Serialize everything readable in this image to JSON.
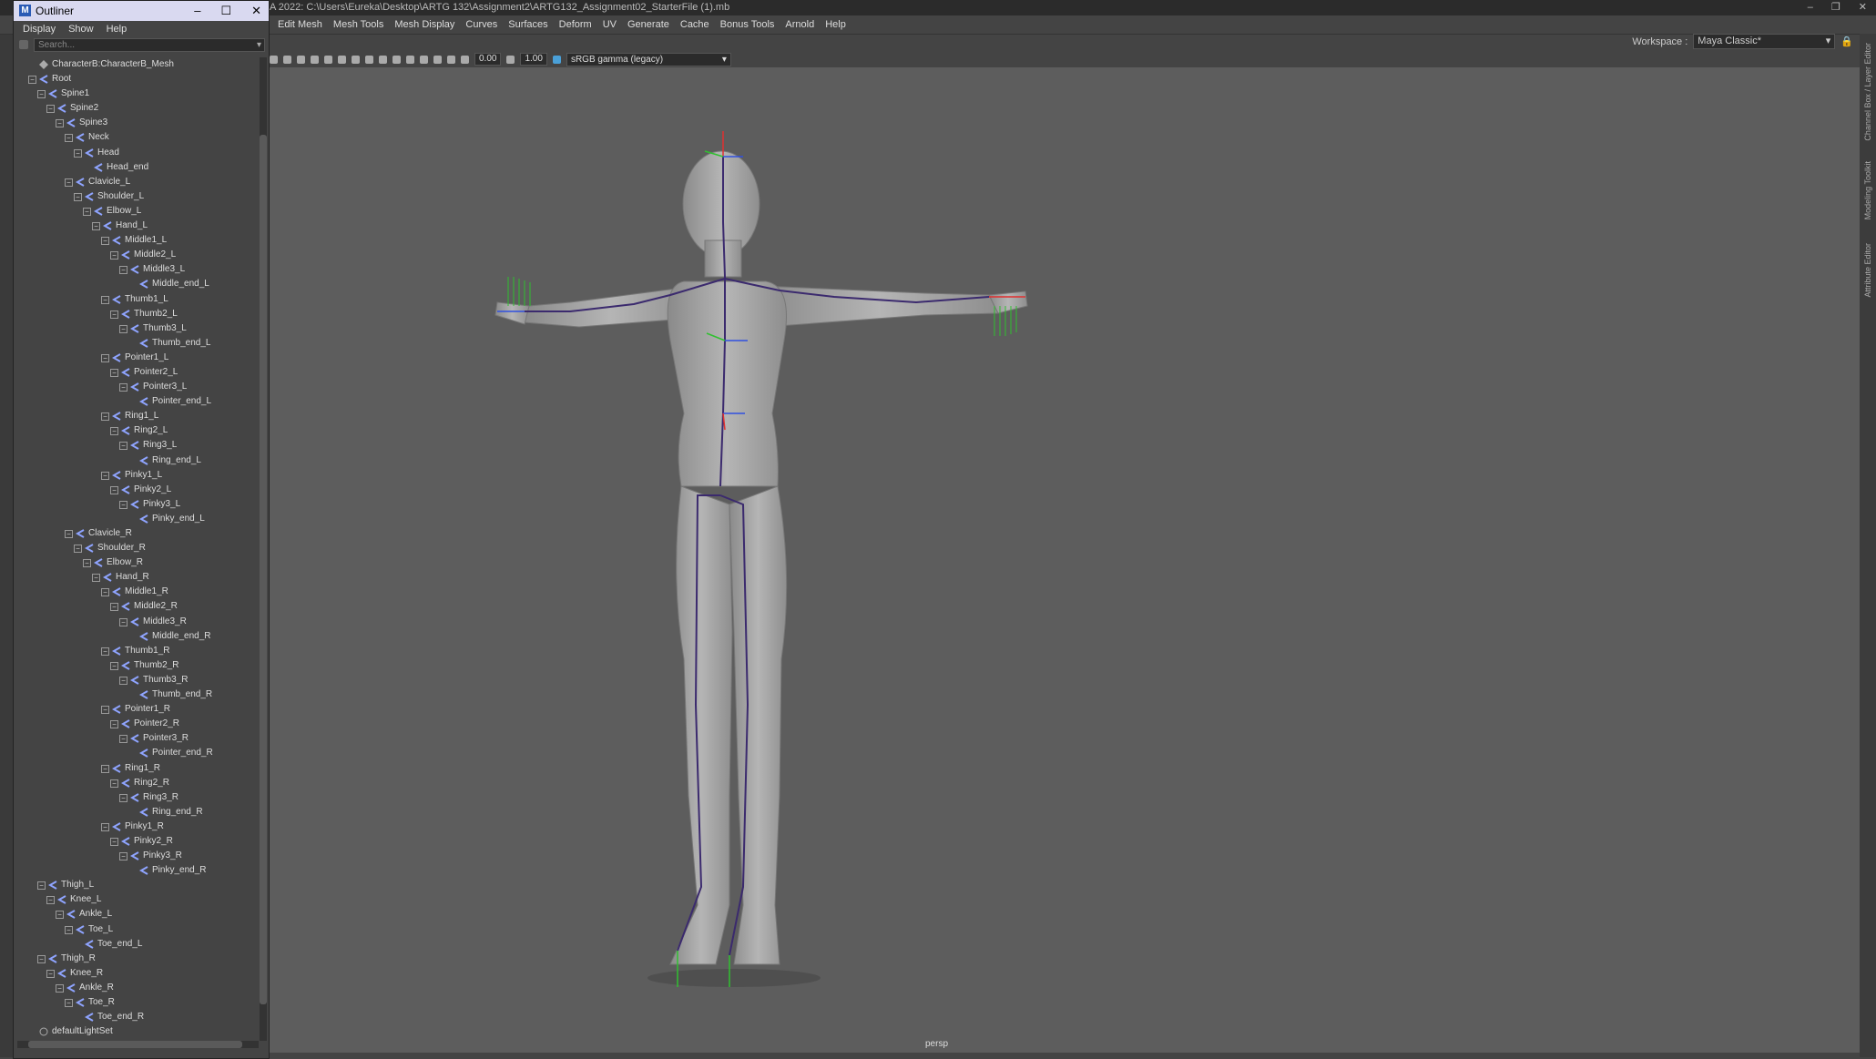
{
  "window": {
    "title": "A 2022: C:\\Users\\Eureka\\Desktop\\ARTG 132\\Assignment2\\ARTG132_Assignment02_StarterFile (1).mb"
  },
  "menubar": {
    "items": [
      "Edit Mesh",
      "Mesh Tools",
      "Mesh Display",
      "Curves",
      "Surfaces",
      "Deform",
      "UV",
      "Generate",
      "Cache",
      "Bonus Tools",
      "Arnold",
      "Help"
    ]
  },
  "workspace": {
    "label": "Workspace :",
    "value": "Maya Classic*"
  },
  "view_toolbar": {
    "exposure": "0.00",
    "gamma": "1.00",
    "colorspace": "sRGB gamma (legacy)"
  },
  "viewport": {
    "camera_label": "persp"
  },
  "right_panel": {
    "tabs": [
      "Channel Box / Layer Editor",
      "Modeling Toolkit",
      "Attribute Editor"
    ]
  },
  "outliner": {
    "title": "Outliner",
    "menu": [
      "Display",
      "Show",
      "Help"
    ],
    "search_placeholder": "Search...",
    "tree": [
      {
        "label": "CharacterB:CharacterB_Mesh",
        "depth": 0,
        "kind": "mesh",
        "exp": ""
      },
      {
        "label": "Root",
        "depth": 0,
        "kind": "joint",
        "exp": "-"
      },
      {
        "label": "Spine1",
        "depth": 1,
        "kind": "joint",
        "exp": "-"
      },
      {
        "label": "Spine2",
        "depth": 2,
        "kind": "joint",
        "exp": "-"
      },
      {
        "label": "Spine3",
        "depth": 3,
        "kind": "joint",
        "exp": "-"
      },
      {
        "label": "Neck",
        "depth": 4,
        "kind": "joint",
        "exp": "-"
      },
      {
        "label": "Head",
        "depth": 5,
        "kind": "joint",
        "exp": "-"
      },
      {
        "label": "Head_end",
        "depth": 6,
        "kind": "joint",
        "exp": ""
      },
      {
        "label": "Clavicle_L",
        "depth": 4,
        "kind": "joint",
        "exp": "-"
      },
      {
        "label": "Shoulder_L",
        "depth": 5,
        "kind": "joint",
        "exp": "-"
      },
      {
        "label": "Elbow_L",
        "depth": 6,
        "kind": "joint",
        "exp": "-"
      },
      {
        "label": "Hand_L",
        "depth": 7,
        "kind": "joint",
        "exp": "-"
      },
      {
        "label": "Middle1_L",
        "depth": 8,
        "kind": "joint",
        "exp": "-"
      },
      {
        "label": "Middle2_L",
        "depth": 9,
        "kind": "joint",
        "exp": "-"
      },
      {
        "label": "Middle3_L",
        "depth": 10,
        "kind": "joint",
        "exp": "-"
      },
      {
        "label": "Middle_end_L",
        "depth": 11,
        "kind": "joint",
        "exp": ""
      },
      {
        "label": "Thumb1_L",
        "depth": 8,
        "kind": "joint",
        "exp": "-"
      },
      {
        "label": "Thumb2_L",
        "depth": 9,
        "kind": "joint",
        "exp": "-"
      },
      {
        "label": "Thumb3_L",
        "depth": 10,
        "kind": "joint",
        "exp": "-"
      },
      {
        "label": "Thumb_end_L",
        "depth": 11,
        "kind": "joint",
        "exp": ""
      },
      {
        "label": "Pointer1_L",
        "depth": 8,
        "kind": "joint",
        "exp": "-"
      },
      {
        "label": "Pointer2_L",
        "depth": 9,
        "kind": "joint",
        "exp": "-"
      },
      {
        "label": "Pointer3_L",
        "depth": 10,
        "kind": "joint",
        "exp": "-"
      },
      {
        "label": "Pointer_end_L",
        "depth": 11,
        "kind": "joint",
        "exp": ""
      },
      {
        "label": "Ring1_L",
        "depth": 8,
        "kind": "joint",
        "exp": "-"
      },
      {
        "label": "Ring2_L",
        "depth": 9,
        "kind": "joint",
        "exp": "-"
      },
      {
        "label": "Ring3_L",
        "depth": 10,
        "kind": "joint",
        "exp": "-"
      },
      {
        "label": "Ring_end_L",
        "depth": 11,
        "kind": "joint",
        "exp": ""
      },
      {
        "label": "Pinky1_L",
        "depth": 8,
        "kind": "joint",
        "exp": "-"
      },
      {
        "label": "Pinky2_L",
        "depth": 9,
        "kind": "joint",
        "exp": "-"
      },
      {
        "label": "Pinky3_L",
        "depth": 10,
        "kind": "joint",
        "exp": "-"
      },
      {
        "label": "Pinky_end_L",
        "depth": 11,
        "kind": "joint",
        "exp": ""
      },
      {
        "label": "Clavicle_R",
        "depth": 4,
        "kind": "joint",
        "exp": "-"
      },
      {
        "label": "Shoulder_R",
        "depth": 5,
        "kind": "joint",
        "exp": "-"
      },
      {
        "label": "Elbow_R",
        "depth": 6,
        "kind": "joint",
        "exp": "-"
      },
      {
        "label": "Hand_R",
        "depth": 7,
        "kind": "joint",
        "exp": "-"
      },
      {
        "label": "Middle1_R",
        "depth": 8,
        "kind": "joint",
        "exp": "-"
      },
      {
        "label": "Middle2_R",
        "depth": 9,
        "kind": "joint",
        "exp": "-"
      },
      {
        "label": "Middle3_R",
        "depth": 10,
        "kind": "joint",
        "exp": "-"
      },
      {
        "label": "Middle_end_R",
        "depth": 11,
        "kind": "joint",
        "exp": ""
      },
      {
        "label": "Thumb1_R",
        "depth": 8,
        "kind": "joint",
        "exp": "-"
      },
      {
        "label": "Thumb2_R",
        "depth": 9,
        "kind": "joint",
        "exp": "-"
      },
      {
        "label": "Thumb3_R",
        "depth": 10,
        "kind": "joint",
        "exp": "-"
      },
      {
        "label": "Thumb_end_R",
        "depth": 11,
        "kind": "joint",
        "exp": ""
      },
      {
        "label": "Pointer1_R",
        "depth": 8,
        "kind": "joint",
        "exp": "-"
      },
      {
        "label": "Pointer2_R",
        "depth": 9,
        "kind": "joint",
        "exp": "-"
      },
      {
        "label": "Pointer3_R",
        "depth": 10,
        "kind": "joint",
        "exp": "-"
      },
      {
        "label": "Pointer_end_R",
        "depth": 11,
        "kind": "joint",
        "exp": ""
      },
      {
        "label": "Ring1_R",
        "depth": 8,
        "kind": "joint",
        "exp": "-"
      },
      {
        "label": "Ring2_R",
        "depth": 9,
        "kind": "joint",
        "exp": "-"
      },
      {
        "label": "Ring3_R",
        "depth": 10,
        "kind": "joint",
        "exp": "-"
      },
      {
        "label": "Ring_end_R",
        "depth": 11,
        "kind": "joint",
        "exp": ""
      },
      {
        "label": "Pinky1_R",
        "depth": 8,
        "kind": "joint",
        "exp": "-"
      },
      {
        "label": "Pinky2_R",
        "depth": 9,
        "kind": "joint",
        "exp": "-"
      },
      {
        "label": "Pinky3_R",
        "depth": 10,
        "kind": "joint",
        "exp": "-"
      },
      {
        "label": "Pinky_end_R",
        "depth": 11,
        "kind": "joint",
        "exp": ""
      },
      {
        "label": "Thigh_L",
        "depth": 1,
        "kind": "joint",
        "exp": "-"
      },
      {
        "label": "Knee_L",
        "depth": 2,
        "kind": "joint",
        "exp": "-"
      },
      {
        "label": "Ankle_L",
        "depth": 3,
        "kind": "joint",
        "exp": "-"
      },
      {
        "label": "Toe_L",
        "depth": 4,
        "kind": "joint",
        "exp": "-"
      },
      {
        "label": "Toe_end_L",
        "depth": 5,
        "kind": "joint",
        "exp": ""
      },
      {
        "label": "Thigh_R",
        "depth": 1,
        "kind": "joint",
        "exp": "-"
      },
      {
        "label": "Knee_R",
        "depth": 2,
        "kind": "joint",
        "exp": "-"
      },
      {
        "label": "Ankle_R",
        "depth": 3,
        "kind": "joint",
        "exp": "-"
      },
      {
        "label": "Toe_R",
        "depth": 4,
        "kind": "joint",
        "exp": "-"
      },
      {
        "label": "Toe_end_R",
        "depth": 5,
        "kind": "joint",
        "exp": ""
      },
      {
        "label": "defaultLightSet",
        "depth": 0,
        "kind": "set",
        "exp": ""
      }
    ]
  },
  "colors": {
    "joint_icon": "#8fa4ff",
    "selected_bg": "#5285a6",
    "axis_x": "#e03030",
    "axis_y": "#30c030",
    "axis_z": "#3050e0"
  }
}
